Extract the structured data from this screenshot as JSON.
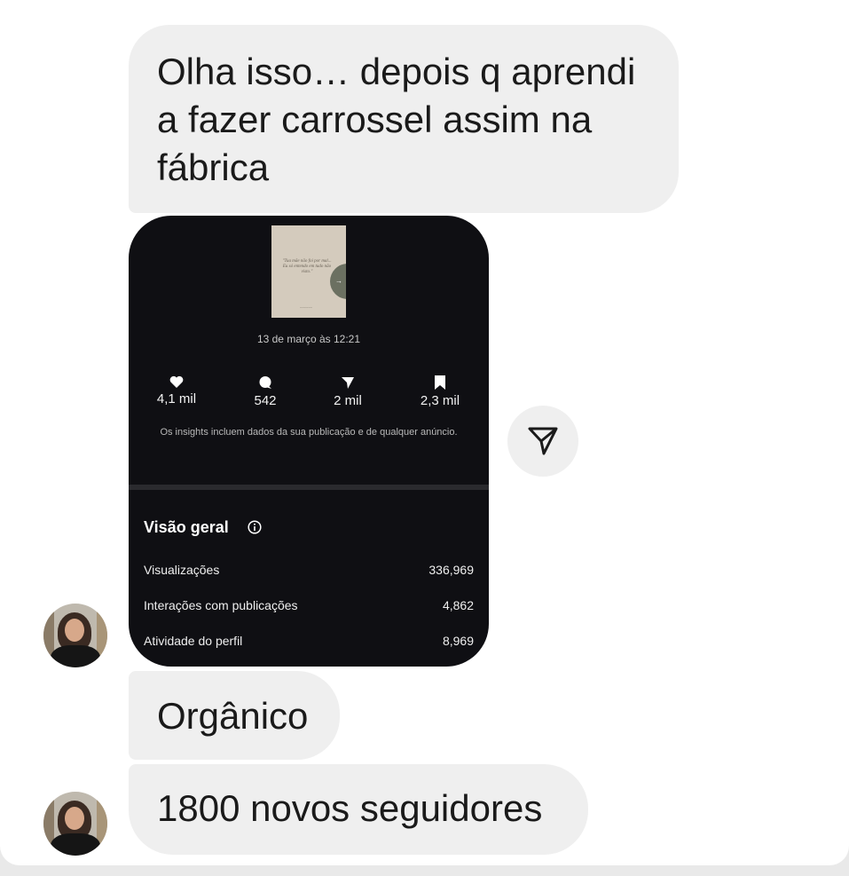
{
  "messages": {
    "m1": "Olha isso… depois q aprendi a fazer carrossel assim na fábrica",
    "m2": "Orgânico",
    "m3": "1800 novos seguidores"
  },
  "post": {
    "thumbnail_text": "\"Tua mãe não foi por mal... Eu só entendo em tudo não visto.\"",
    "date": "13 de março às 12:21",
    "stats": {
      "likes": "4,1 mil",
      "comments": "542",
      "shares": "2 mil",
      "saves": "2,3 mil"
    },
    "note": "Os insights incluem dados da sua publicação e de qualquer anúncio.",
    "overview": {
      "title": "Visão geral",
      "rows": [
        {
          "label": "Visualizações",
          "value": "336,969"
        },
        {
          "label": "Interações com publicações",
          "value": "4,862"
        },
        {
          "label": "Atividade do perfil",
          "value": "8,969"
        }
      ]
    }
  },
  "icons": {
    "share": "paper-plane-icon",
    "like": "heart-icon",
    "comment": "comment-icon",
    "send": "send-icon",
    "save": "bookmark-icon",
    "info": "info-icon"
  },
  "colors": {
    "bubble": "#efefef",
    "post_bg": "#0f0f13",
    "text": "#1a1a1a"
  }
}
